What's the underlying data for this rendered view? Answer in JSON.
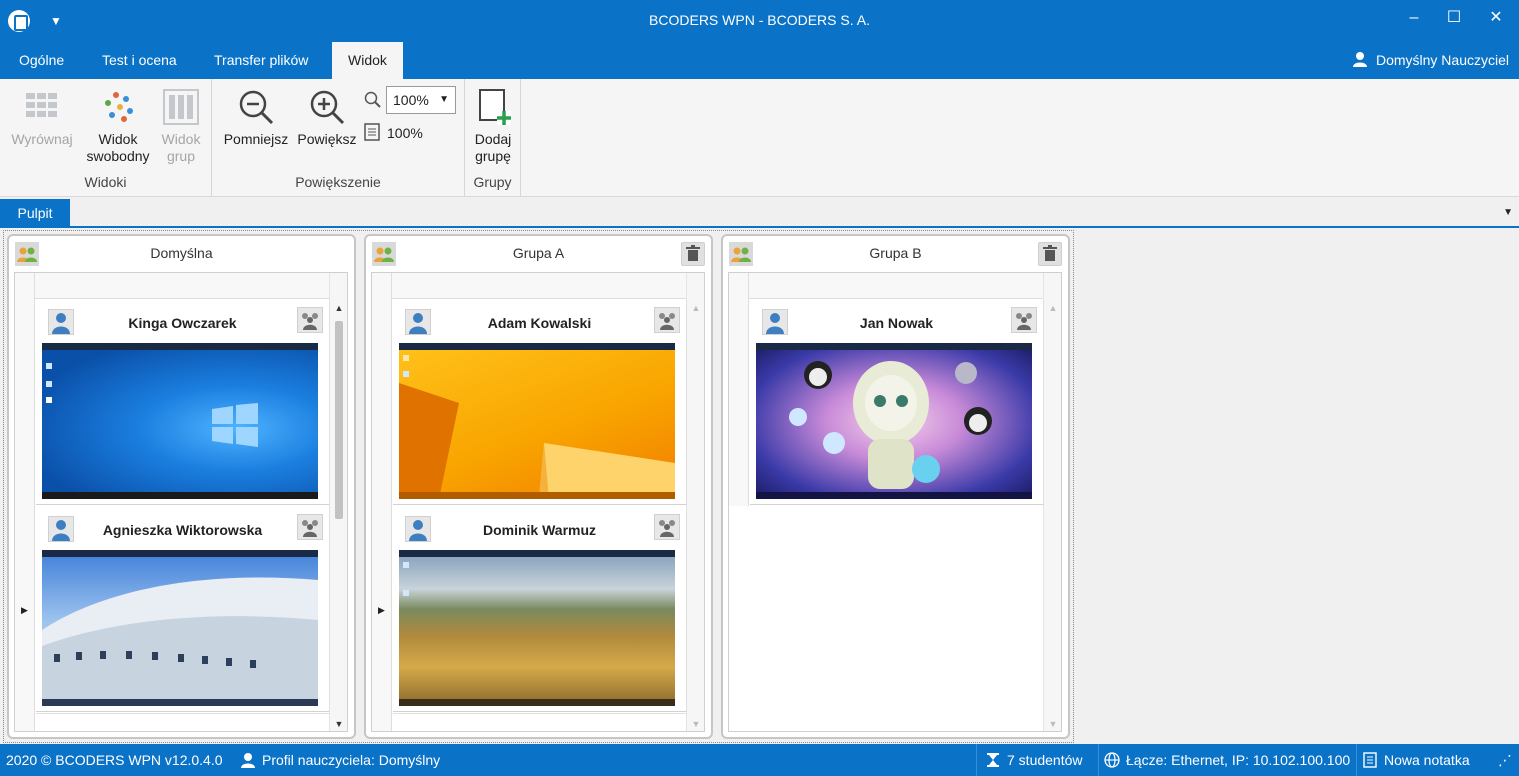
{
  "window": {
    "title": "BCODERS WPN - BCODERS S. A.",
    "minimize": "–",
    "maximize": "☐",
    "close": "✕"
  },
  "ribbon_tabs": [
    {
      "label": "Ogólne"
    },
    {
      "label": "Test i ocena"
    },
    {
      "label": "Transfer plików"
    },
    {
      "label": "Widok",
      "active": true
    }
  ],
  "user": {
    "label": "Domyślny Nauczyciel"
  },
  "ribbon": {
    "groups": {
      "widoki": {
        "label": "Widoki"
      },
      "powiekszenie": {
        "label": "Powiększenie"
      },
      "grupy": {
        "label": "Grupy"
      }
    },
    "buttons": {
      "wyrownaj": {
        "label": "Wyrównaj",
        "enabled": false
      },
      "widok_swobodny_1": "Widok",
      "widok_swobodny_2": "swobodny",
      "widok_grup_1": "Widok",
      "widok_grup_2": "grup",
      "pomniejsz": "Pomniejsz",
      "powieksz": "Powiększ",
      "dodaj_grupe_1": "Dodaj",
      "dodaj_grupe_2": "grupę"
    },
    "zoom_select": "100%",
    "page_zoom": "100%"
  },
  "doc_tab": {
    "label": "Pulpit"
  },
  "groups": [
    {
      "name": "Domyślna",
      "students": [
        {
          "name": "Kinga Owczarek",
          "screen": "windows10"
        },
        {
          "name": "Agnieszka Wiktorowska",
          "screen": "building"
        }
      ]
    },
    {
      "name": "Grupa A",
      "students": [
        {
          "name": "Adam Kowalski",
          "screen": "windows8"
        },
        {
          "name": "Dominik Warmuz",
          "screen": "field"
        }
      ]
    },
    {
      "name": "Grupa B",
      "students": [
        {
          "name": "Jan Nowak",
          "screen": "anime"
        }
      ]
    }
  ],
  "statusbar": {
    "copyright": "2020 ©  BCODERS WPN v12.0.4.0",
    "profile": "Profil nauczyciela: Domyślny",
    "students": "7 studentów",
    "connection": "Łącze: Ethernet, IP: 10.102.100.100",
    "note": "Nowa notatka"
  },
  "colors": {
    "accent": "#0a73c8",
    "ribbon_bg": "#f5f5f5",
    "canvas_bg": "#f0f0f0"
  }
}
